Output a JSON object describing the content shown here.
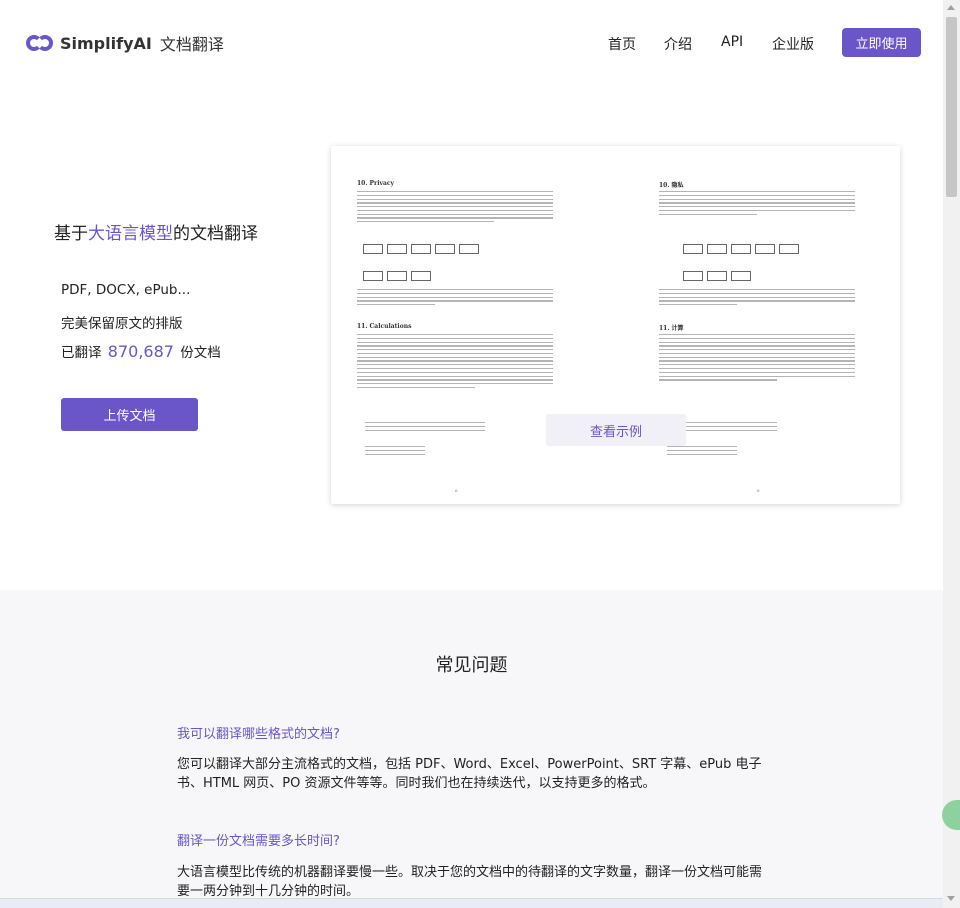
{
  "header": {
    "brand": "SimplifyAI",
    "product": "文档翻译",
    "nav": [
      {
        "label": "首页"
      },
      {
        "label": "介绍"
      },
      {
        "label": "API"
      },
      {
        "label": "企业版"
      }
    ],
    "cta_label": "立即使用"
  },
  "hero": {
    "title_prefix": "基于",
    "title_highlight": "大语言模型",
    "title_suffix": "的文档翻译",
    "formats": "PDF, DOCX, ePub...",
    "layout": "完美保留原文的排版",
    "count_prefix": "已翻译",
    "count_value": "870,687",
    "count_suffix": "份文档",
    "upload_label": "上传文档"
  },
  "preview": {
    "left_section1": "10.   Privacy",
    "left_section2": "11.   Calculations",
    "right_section1": "10. 隐私",
    "right_section2": "11. 计算",
    "page_number_left": "6",
    "page_number_right": "6",
    "demo_label": "查看示例"
  },
  "faq": {
    "title": "常见问题",
    "items": [
      {
        "question": "我可以翻译哪些格式的文档?",
        "answer": "您可以翻译大部分主流格式的文档，包括 PDF、Word、Excel、PowerPoint、SRT 字幕、ePub 电子书、HTML 网页、PO 资源文件等等。同时我们也在持续迭代，以支持更多的格式。"
      },
      {
        "question": "翻译一份文档需要多长时间?",
        "answer": "大语言模型比传统的机器翻译要慢一些。取决于您的文档中的待翻译的文字数量，翻译一份文档可能需要一两分钟到十几分钟的时间。"
      }
    ]
  },
  "colors": {
    "accent": "#6b56c9",
    "faq_background": "#f7f7f9"
  }
}
